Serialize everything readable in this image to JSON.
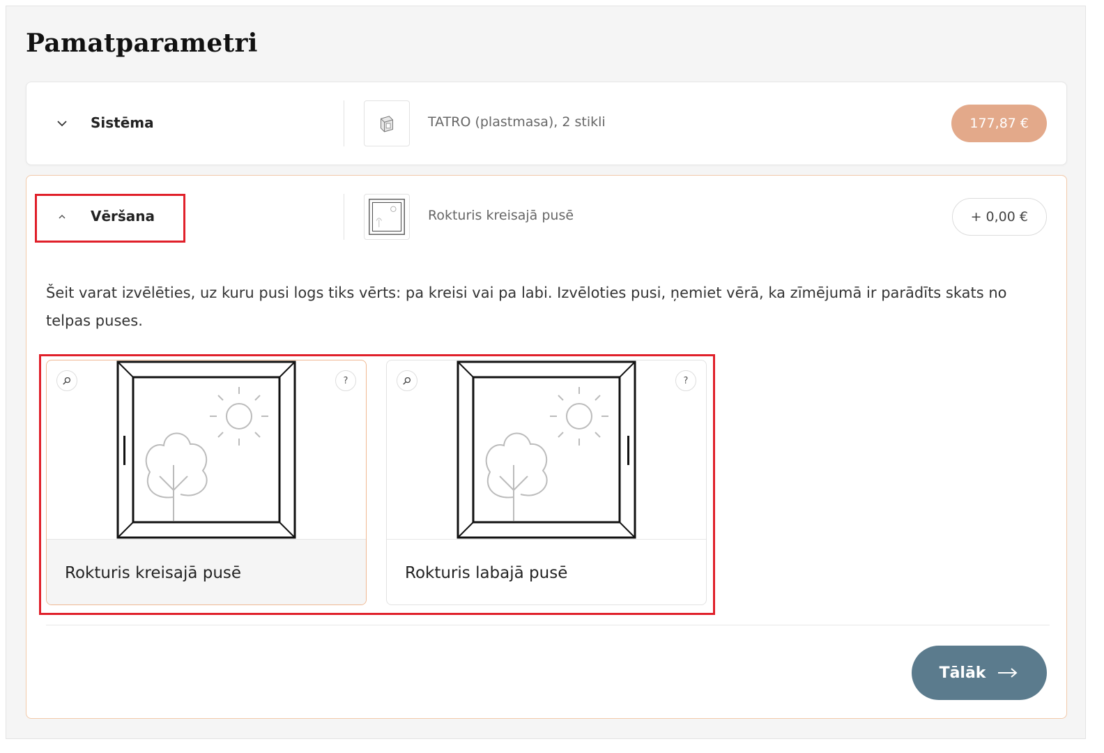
{
  "page": {
    "title": "Pamatparametri"
  },
  "system": {
    "label": "Sistēma",
    "value": "TATRO (plastmasa), 2 stikli",
    "price": "177,87 €",
    "thumb_icon": "window-profile-icon"
  },
  "opening": {
    "label": "Vēršana",
    "value": "Rokturis kreisajā pusē",
    "price": "+ 0,00 €",
    "thumb_icon": "window-thumbnail-icon",
    "description": "Šeit varat izvēlēties, uz kuru pusi logs tiks vērts: pa kreisi vai pa labi. Izvēloties pusi, ņemiet vērā, ka zīmējumā ir parādīts skats no telpas puses.",
    "options": [
      {
        "label": "Rokturis kreisajā pusē",
        "handle_side": "left",
        "selected": true
      },
      {
        "label": "Rokturis labajā pusē",
        "handle_side": "right",
        "selected": false
      }
    ],
    "zoom_icon": "magnifier-icon",
    "help_symbol": "?"
  },
  "next_button": {
    "label": "Tālāk",
    "icon": "arrow-right-icon"
  },
  "colors": {
    "accent": "#e3a98a",
    "button": "#5b7b8d",
    "highlight": "#e0202a",
    "selected_border": "#f0b892"
  }
}
